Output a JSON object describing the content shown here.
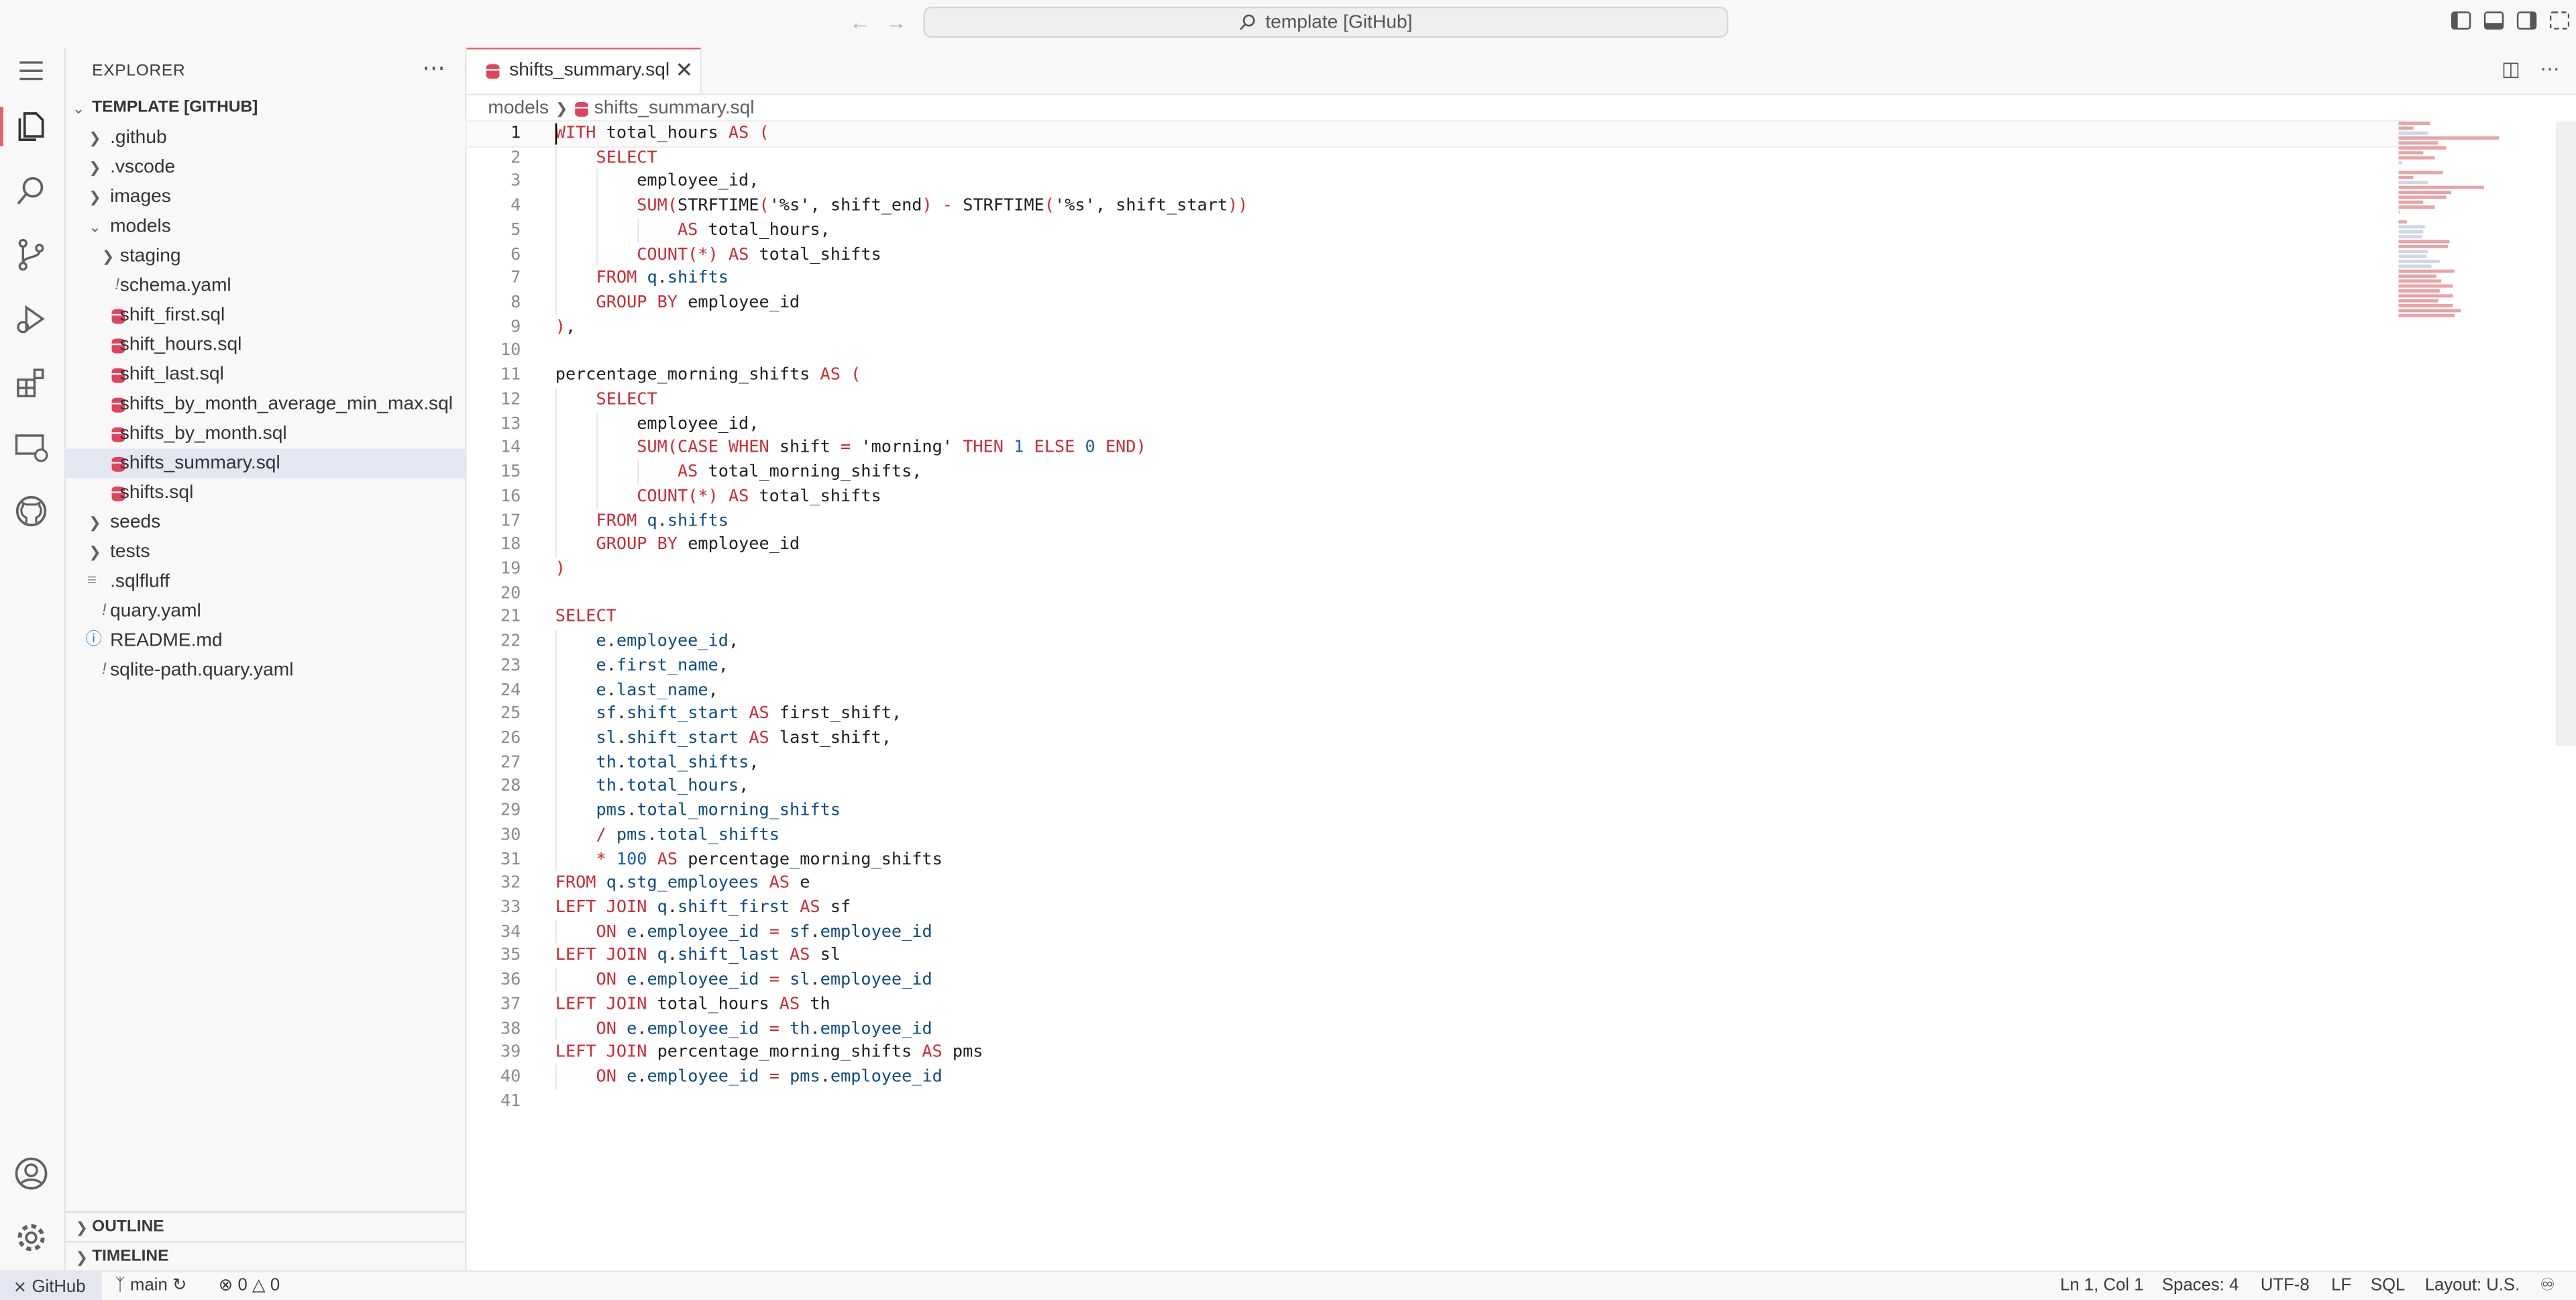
{
  "titlebar": {
    "command_center": "template [GitHub]",
    "nav_back_icon": "arrow-left-icon",
    "nav_forward_icon": "arrow-right-icon"
  },
  "explorer": {
    "title": "EXPLORER",
    "root": "TEMPLATE [GITHUB]",
    "items": [
      {
        "label": ".github",
        "kind": "folder",
        "depth": 1
      },
      {
        "label": ".vscode",
        "kind": "folder",
        "depth": 1
      },
      {
        "label": "images",
        "kind": "folder",
        "depth": 1
      },
      {
        "label": "models",
        "kind": "folder-open",
        "depth": 1
      },
      {
        "label": "staging",
        "kind": "folder",
        "depth": 2
      },
      {
        "label": "schema.yaml",
        "kind": "yaml",
        "depth": 2
      },
      {
        "label": "shift_first.sql",
        "kind": "sql",
        "depth": 2
      },
      {
        "label": "shift_hours.sql",
        "kind": "sql",
        "depth": 2
      },
      {
        "label": "shift_last.sql",
        "kind": "sql",
        "depth": 2
      },
      {
        "label": "shifts_by_month_average_min_max.sql",
        "kind": "sql",
        "depth": 2
      },
      {
        "label": "shifts_by_month.sql",
        "kind": "sql",
        "depth": 2
      },
      {
        "label": "shifts_summary.sql",
        "kind": "sql",
        "depth": 2,
        "selected": true
      },
      {
        "label": "shifts.sql",
        "kind": "sql",
        "depth": 2
      },
      {
        "label": "seeds",
        "kind": "folder",
        "depth": 1
      },
      {
        "label": "tests",
        "kind": "folder",
        "depth": 1
      },
      {
        "label": ".sqlfluff",
        "kind": "lines",
        "depth": 1
      },
      {
        "label": "quary.yaml",
        "kind": "yaml",
        "depth": 1
      },
      {
        "label": "README.md",
        "kind": "info",
        "depth": 1
      },
      {
        "label": "sqlite-path.quary.yaml",
        "kind": "yaml",
        "depth": 1
      }
    ],
    "outline": "OUTLINE",
    "timeline": "TIMELINE"
  },
  "editor": {
    "tab_label": "shifts_summary.sql",
    "breadcrumb": [
      "models",
      "shifts_summary.sql"
    ],
    "lines": [
      [
        [
          "kw",
          "WITH"
        ],
        [
          "id",
          " total_hours "
        ],
        [
          "kw",
          "AS"
        ],
        [
          "punc",
          " "
        ],
        [
          "paren",
          "("
        ]
      ],
      [
        [
          "id",
          "    "
        ],
        [
          "kw",
          "SELECT"
        ]
      ],
      [
        [
          "id",
          "        employee_id,"
        ]
      ],
      [
        [
          "id",
          "        "
        ],
        [
          "kw",
          "SUM"
        ],
        [
          "paren",
          "("
        ],
        [
          "fn",
          "STRFTIME"
        ],
        [
          "paren",
          "("
        ],
        [
          "str",
          "'%s'"
        ],
        [
          "punc",
          ", shift_end"
        ],
        [
          "paren",
          ")"
        ],
        [
          "op",
          " - "
        ],
        [
          "fn",
          "STRFTIME"
        ],
        [
          "paren",
          "("
        ],
        [
          "str",
          "'%s'"
        ],
        [
          "punc",
          ", shift_start"
        ],
        [
          "paren",
          "))"
        ]
      ],
      [
        [
          "id",
          "            "
        ],
        [
          "kw",
          "AS"
        ],
        [
          "id",
          " total_hours,"
        ]
      ],
      [
        [
          "id",
          "        "
        ],
        [
          "kw",
          "COUNT"
        ],
        [
          "paren",
          "("
        ],
        [
          "op",
          "*"
        ],
        [
          "paren",
          ")"
        ],
        [
          "punc",
          " "
        ],
        [
          "kw",
          "AS"
        ],
        [
          "id",
          " total_shifts"
        ]
      ],
      [
        [
          "id",
          "    "
        ],
        [
          "kw",
          "FROM"
        ],
        [
          "punc",
          " "
        ],
        [
          "qual",
          "q"
        ],
        [
          "punc",
          "."
        ],
        [
          "col",
          "shifts"
        ]
      ],
      [
        [
          "id",
          "    "
        ],
        [
          "kw",
          "GROUP BY"
        ],
        [
          "id",
          " employee_id"
        ]
      ],
      [
        [
          "paren",
          ")"
        ],
        [
          "punc",
          ","
        ]
      ],
      [],
      [
        [
          "id",
          "percentage_morning_shifts "
        ],
        [
          "kw",
          "AS"
        ],
        [
          "punc",
          " "
        ],
        [
          "paren",
          "("
        ]
      ],
      [
        [
          "id",
          "    "
        ],
        [
          "kw",
          "SELECT"
        ]
      ],
      [
        [
          "id",
          "        employee_id,"
        ]
      ],
      [
        [
          "id",
          "        "
        ],
        [
          "kw",
          "SUM"
        ],
        [
          "paren",
          "("
        ],
        [
          "kw",
          "CASE WHEN"
        ],
        [
          "id",
          " shift "
        ],
        [
          "op",
          "="
        ],
        [
          "str",
          " 'morning' "
        ],
        [
          "kw",
          "THEN"
        ],
        [
          "num",
          " 1 "
        ],
        [
          "kw",
          "ELSE"
        ],
        [
          "num",
          " 0 "
        ],
        [
          "kw",
          "END"
        ],
        [
          "paren",
          ")"
        ]
      ],
      [
        [
          "id",
          "            "
        ],
        [
          "kw",
          "AS"
        ],
        [
          "id",
          " total_morning_shifts,"
        ]
      ],
      [
        [
          "id",
          "        "
        ],
        [
          "kw",
          "COUNT"
        ],
        [
          "paren",
          "("
        ],
        [
          "op",
          "*"
        ],
        [
          "paren",
          ")"
        ],
        [
          "punc",
          " "
        ],
        [
          "kw",
          "AS"
        ],
        [
          "id",
          " total_shifts"
        ]
      ],
      [
        [
          "id",
          "    "
        ],
        [
          "kw",
          "FROM"
        ],
        [
          "punc",
          " "
        ],
        [
          "qual",
          "q"
        ],
        [
          "punc",
          "."
        ],
        [
          "col",
          "shifts"
        ]
      ],
      [
        [
          "id",
          "    "
        ],
        [
          "kw",
          "GROUP BY"
        ],
        [
          "id",
          " employee_id"
        ]
      ],
      [
        [
          "paren",
          ")"
        ]
      ],
      [],
      [
        [
          "kw",
          "SELECT"
        ]
      ],
      [
        [
          "id",
          "    "
        ],
        [
          "qual",
          "e"
        ],
        [
          "punc",
          "."
        ],
        [
          "col",
          "employee_id"
        ],
        [
          "punc",
          ","
        ]
      ],
      [
        [
          "id",
          "    "
        ],
        [
          "qual",
          "e"
        ],
        [
          "punc",
          "."
        ],
        [
          "col",
          "first_name"
        ],
        [
          "punc",
          ","
        ]
      ],
      [
        [
          "id",
          "    "
        ],
        [
          "qual",
          "e"
        ],
        [
          "punc",
          "."
        ],
        [
          "col",
          "last_name"
        ],
        [
          "punc",
          ","
        ]
      ],
      [
        [
          "id",
          "    "
        ],
        [
          "qual",
          "sf"
        ],
        [
          "punc",
          "."
        ],
        [
          "col",
          "shift_start"
        ],
        [
          "punc",
          " "
        ],
        [
          "kw",
          "AS"
        ],
        [
          "id",
          " first_shift,"
        ]
      ],
      [
        [
          "id",
          "    "
        ],
        [
          "qual",
          "sl"
        ],
        [
          "punc",
          "."
        ],
        [
          "col",
          "shift_start"
        ],
        [
          "punc",
          " "
        ],
        [
          "kw",
          "AS"
        ],
        [
          "id",
          " last_shift,"
        ]
      ],
      [
        [
          "id",
          "    "
        ],
        [
          "qual",
          "th"
        ],
        [
          "punc",
          "."
        ],
        [
          "col",
          "total_shifts"
        ],
        [
          "punc",
          ","
        ]
      ],
      [
        [
          "id",
          "    "
        ],
        [
          "qual",
          "th"
        ],
        [
          "punc",
          "."
        ],
        [
          "col",
          "total_hours"
        ],
        [
          "punc",
          ","
        ]
      ],
      [
        [
          "id",
          "    "
        ],
        [
          "qual",
          "pms"
        ],
        [
          "punc",
          "."
        ],
        [
          "col",
          "total_morning_shifts"
        ]
      ],
      [
        [
          "id",
          "    "
        ],
        [
          "op",
          "/"
        ],
        [
          "punc",
          " "
        ],
        [
          "qual",
          "pms"
        ],
        [
          "punc",
          "."
        ],
        [
          "col",
          "total_shifts"
        ]
      ],
      [
        [
          "id",
          "    "
        ],
        [
          "op",
          "*"
        ],
        [
          "num",
          " 100 "
        ],
        [
          "kw",
          "AS"
        ],
        [
          "id",
          " percentage_morning_shifts"
        ]
      ],
      [
        [
          "kw",
          "FROM"
        ],
        [
          "punc",
          " "
        ],
        [
          "qual",
          "q"
        ],
        [
          "punc",
          "."
        ],
        [
          "col",
          "stg_employees"
        ],
        [
          "punc",
          " "
        ],
        [
          "kw",
          "AS"
        ],
        [
          "id",
          " e"
        ]
      ],
      [
        [
          "kw",
          "LEFT JOIN"
        ],
        [
          "punc",
          " "
        ],
        [
          "qual",
          "q"
        ],
        [
          "punc",
          "."
        ],
        [
          "col",
          "shift_first"
        ],
        [
          "punc",
          " "
        ],
        [
          "kw",
          "AS"
        ],
        [
          "id",
          " sf"
        ]
      ],
      [
        [
          "id",
          "    "
        ],
        [
          "kw",
          "ON"
        ],
        [
          "punc",
          " "
        ],
        [
          "qual",
          "e"
        ],
        [
          "punc",
          "."
        ],
        [
          "col",
          "employee_id"
        ],
        [
          "op",
          " = "
        ],
        [
          "qual",
          "sf"
        ],
        [
          "punc",
          "."
        ],
        [
          "col",
          "employee_id"
        ]
      ],
      [
        [
          "kw",
          "LEFT JOIN"
        ],
        [
          "punc",
          " "
        ],
        [
          "qual",
          "q"
        ],
        [
          "punc",
          "."
        ],
        [
          "col",
          "shift_last"
        ],
        [
          "punc",
          " "
        ],
        [
          "kw",
          "AS"
        ],
        [
          "id",
          " sl"
        ]
      ],
      [
        [
          "id",
          "    "
        ],
        [
          "kw",
          "ON"
        ],
        [
          "punc",
          " "
        ],
        [
          "qual",
          "e"
        ],
        [
          "punc",
          "."
        ],
        [
          "col",
          "employee_id"
        ],
        [
          "op",
          " = "
        ],
        [
          "qual",
          "sl"
        ],
        [
          "punc",
          "."
        ],
        [
          "col",
          "employee_id"
        ]
      ],
      [
        [
          "kw",
          "LEFT JOIN"
        ],
        [
          "id",
          " total_hours "
        ],
        [
          "kw",
          "AS"
        ],
        [
          "id",
          " th"
        ]
      ],
      [
        [
          "id",
          "    "
        ],
        [
          "kw",
          "ON"
        ],
        [
          "punc",
          " "
        ],
        [
          "qual",
          "e"
        ],
        [
          "punc",
          "."
        ],
        [
          "col",
          "employee_id"
        ],
        [
          "op",
          " = "
        ],
        [
          "qual",
          "th"
        ],
        [
          "punc",
          "."
        ],
        [
          "col",
          "employee_id"
        ]
      ],
      [
        [
          "kw",
          "LEFT JOIN"
        ],
        [
          "id",
          " percentage_morning_shifts "
        ],
        [
          "kw",
          "AS"
        ],
        [
          "id",
          " pms"
        ]
      ],
      [
        [
          "id",
          "    "
        ],
        [
          "kw",
          "ON"
        ],
        [
          "punc",
          " "
        ],
        [
          "qual",
          "e"
        ],
        [
          "punc",
          "."
        ],
        [
          "col",
          "employee_id"
        ],
        [
          "op",
          " = "
        ],
        [
          "qual",
          "pms"
        ],
        [
          "punc",
          "."
        ],
        [
          "col",
          "employee_id"
        ]
      ],
      []
    ]
  },
  "statusbar": {
    "remote": "GitHub",
    "branch": "main",
    "errors": "0",
    "warnings": "0",
    "position": "Ln 1, Col 1",
    "spaces": "Spaces: 4",
    "encoding": "UTF-8",
    "eol": "LF",
    "language": "SQL",
    "layout": "Layout: U.S."
  },
  "colors": {
    "accent": "#e3626a",
    "keyword": "#cd2c31",
    "column": "#0f4a85",
    "sql_file_icon": "#e0435b",
    "selection": "#e4e6f1"
  }
}
